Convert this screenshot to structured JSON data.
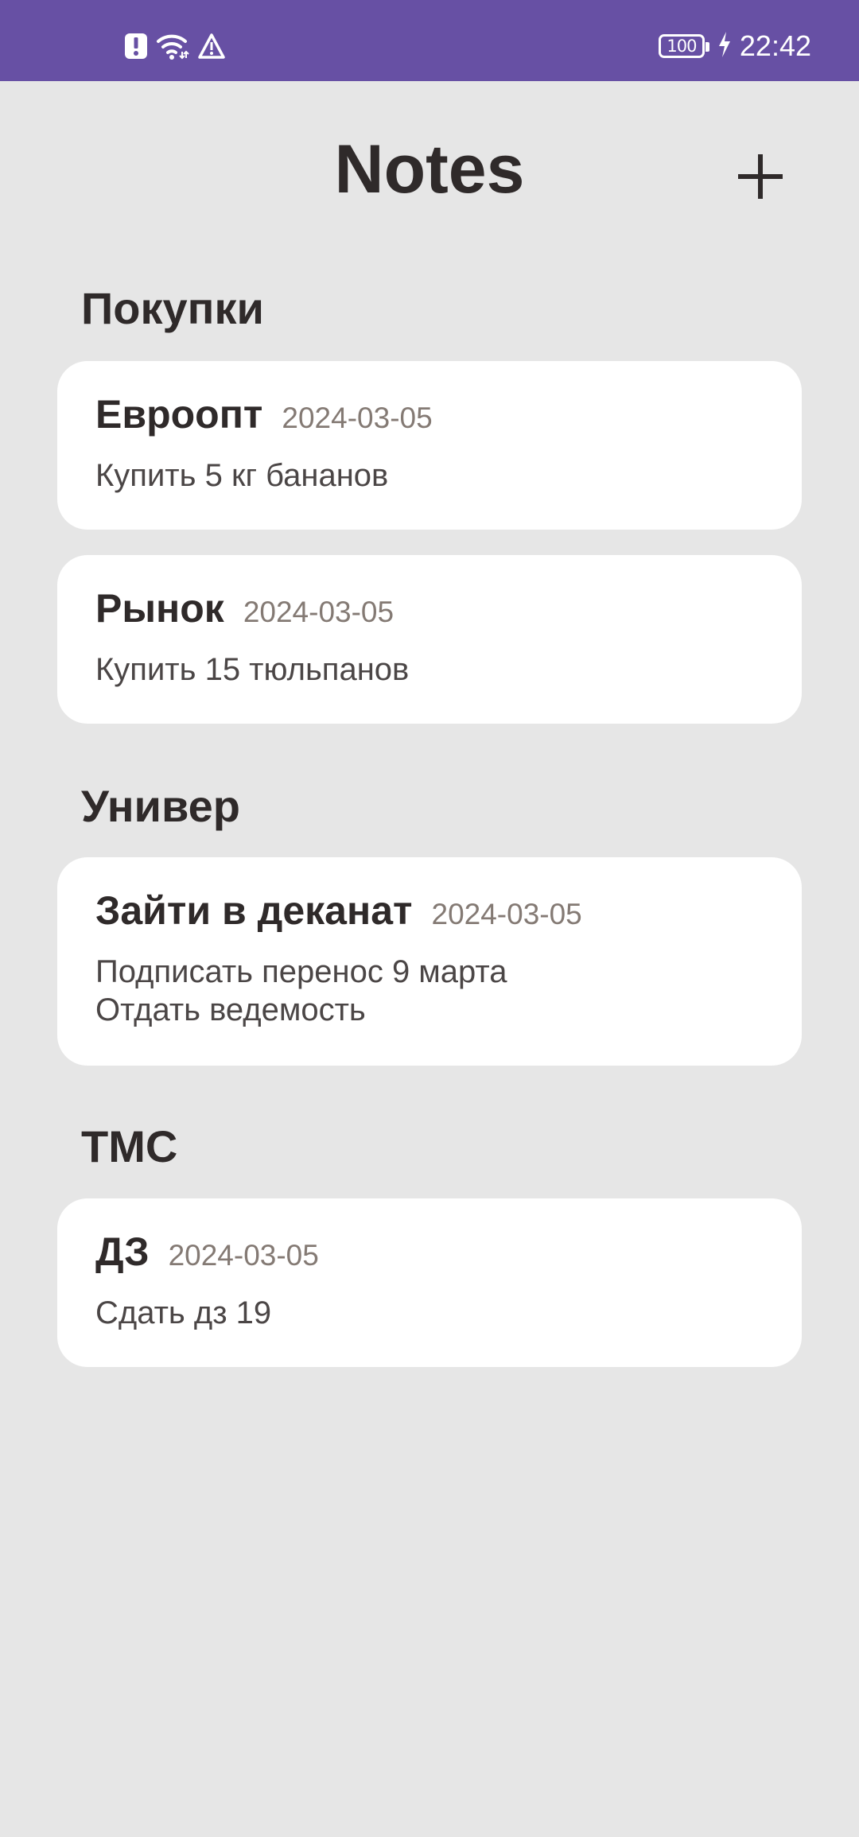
{
  "status_bar": {
    "left_icons": [
      "alert-badge-icon",
      "wifi-icon",
      "warning-icon"
    ],
    "battery_level": "100",
    "time": "22:42",
    "background": "#6750a4"
  },
  "header": {
    "title": "Notes",
    "add_icon": "plus-icon"
  },
  "sections": [
    {
      "title": "Покупки",
      "notes": [
        {
          "title": "Евроопт",
          "date": "2024-03-05",
          "body": [
            "Купить 5 кг бананов"
          ]
        },
        {
          "title": "Рынок",
          "date": "2024-03-05",
          "body": [
            "Купить 15 тюльпанов"
          ]
        }
      ]
    },
    {
      "title": "Универ",
      "notes": [
        {
          "title": "Зайти в деканат",
          "date": "2024-03-05",
          "body": [
            "Подписать перенос 9 марта",
            "Отдать ведемость"
          ]
        }
      ]
    },
    {
      "title": "ТМС",
      "notes": [
        {
          "title": "ДЗ",
          "date": "2024-03-05",
          "body": [
            "Сдать дз 19"
          ]
        }
      ]
    }
  ],
  "colors": {
    "background": "#e6e6e6",
    "card": "#ffffff",
    "text_primary": "#2f2a2a",
    "text_date": "#847a74"
  }
}
